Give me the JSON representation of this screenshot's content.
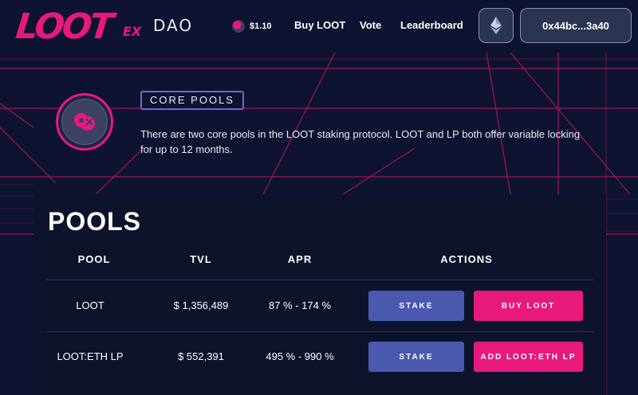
{
  "header": {
    "logo_main": "LOOT",
    "logo_ex": "EX",
    "logo_dao": "DAO",
    "price": "$1.10",
    "nav": [
      "Buy LOOT",
      "Vote",
      "Leaderboard"
    ],
    "network_icon": "ethereum-icon",
    "wallet": "0x44bc...3a40"
  },
  "intro": {
    "badge": "CORE POOLS",
    "description": "There are two core pools in the LOOT staking protocol. LOOT and LP both offer variable locking for up to 12 months."
  },
  "pools": {
    "title": "POOLS",
    "columns": [
      "POOL",
      "TVL",
      "APR",
      "ACTIONS"
    ],
    "rows": [
      {
        "pool": "LOOT",
        "tvl": "$ 1,356,489",
        "apr": "87 % - 174 %",
        "stake": "STAKE",
        "action": "BUY LOOT"
      },
      {
        "pool": "LOOT:ETH LP",
        "tvl": "$ 552,391",
        "apr": "495 % - 990 %",
        "stake": "STAKE",
        "action": "ADD LOOT:ETH LP"
      }
    ]
  },
  "colors": {
    "background": "#0d1330",
    "accent_pink": "#e8197d",
    "stake_blue": "#4a58b0",
    "badge_border": "#6f66d6"
  }
}
